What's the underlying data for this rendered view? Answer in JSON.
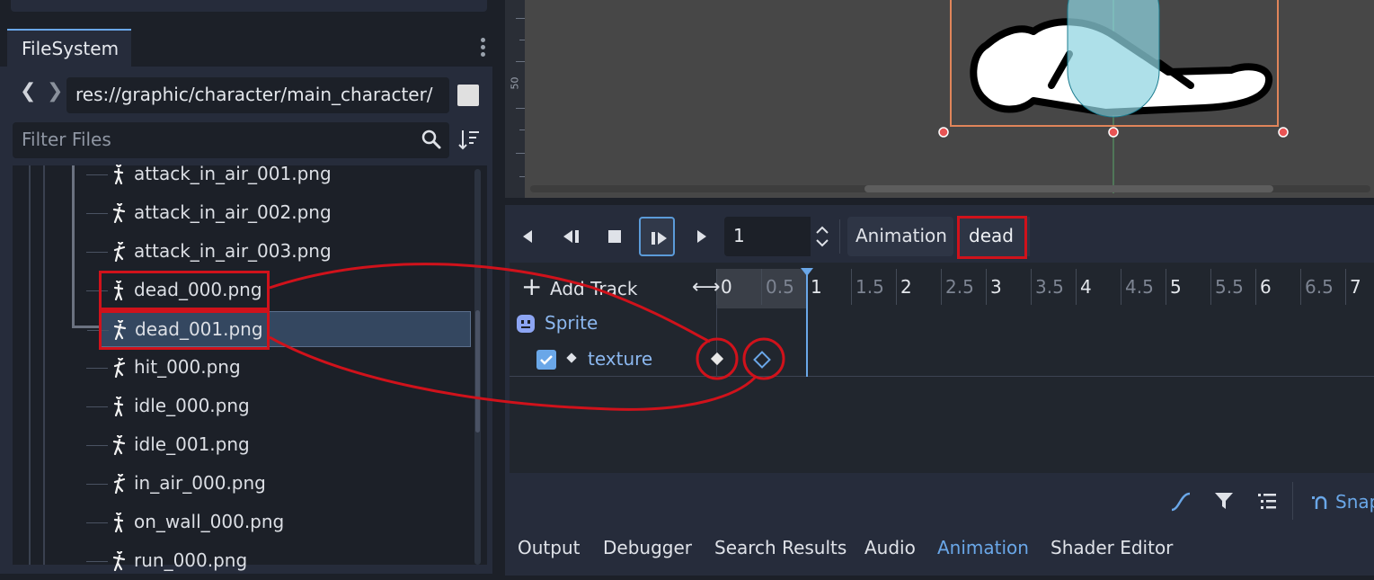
{
  "filesystem": {
    "tab_label": "FileSystem",
    "path": "res://graphic/character/main_character/",
    "filter_placeholder": "Filter Files",
    "files": [
      {
        "name": "attack_in_air_001.png",
        "selected": false
      },
      {
        "name": "attack_in_air_002.png",
        "selected": false
      },
      {
        "name": "attack_in_air_003.png",
        "selected": false
      },
      {
        "name": "dead_000.png",
        "selected": false
      },
      {
        "name": "dead_001.png",
        "selected": true
      },
      {
        "name": "hit_000.png",
        "selected": false
      },
      {
        "name": "idle_000.png",
        "selected": false
      },
      {
        "name": "idle_001.png",
        "selected": false
      },
      {
        "name": "in_air_000.png",
        "selected": false
      },
      {
        "name": "on_wall_000.png",
        "selected": false
      },
      {
        "name": "run_000.png",
        "selected": false
      }
    ]
  },
  "viewport": {
    "ruler_label": "50"
  },
  "animation": {
    "frame_value": "1",
    "animation_button_label": "Animation",
    "current_animation": "dead",
    "add_track_label": "Add Track",
    "timeline_labels": [
      "0",
      "0.5",
      "1",
      "1.5",
      "2",
      "2.5",
      "3",
      "3.5",
      "4",
      "4.5",
      "5",
      "5.5",
      "6",
      "6.5",
      "7"
    ],
    "node_name": "Sprite",
    "track_property": "texture",
    "snap_label": "Snap"
  },
  "bottom_tabs": [
    {
      "label": "Output",
      "active": false
    },
    {
      "label": "Debugger",
      "active": false
    },
    {
      "label": "Search Results",
      "active": false
    },
    {
      "label": "Audio",
      "active": false
    },
    {
      "label": "Animation",
      "active": true
    },
    {
      "label": "Shader Editor",
      "active": false
    }
  ],
  "colors": {
    "accent": "#6aa7e8",
    "annotation_red": "#d0121b",
    "panel_bg": "#262c3b",
    "editor_bg": "#1c2028"
  }
}
